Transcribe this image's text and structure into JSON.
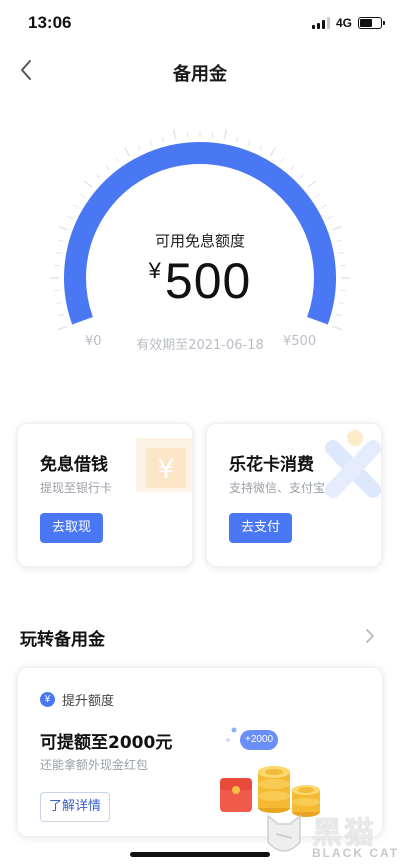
{
  "status_bar": {
    "time": "13:06",
    "network": "4G",
    "battery_level": 0.62
  },
  "nav": {
    "title": "备用金",
    "back_icon": "chevron-left-icon"
  },
  "gauge": {
    "label": "可用免息额度",
    "currency": "¥",
    "amount": "500",
    "min_label": "¥0",
    "max_label": "¥500",
    "validity": "有效期至2021-06-18",
    "fill_fraction": 1.0,
    "accent": "#4a78f5"
  },
  "cards": {
    "cash": {
      "title": "免息借钱",
      "subtitle": "提现至银行卡",
      "button": "去取现",
      "icon": "yen-card-icon"
    },
    "pay": {
      "title": "乐花卡消费",
      "subtitle": "支持微信、支付宝",
      "button": "去支付",
      "icon": "x-logo-icon"
    }
  },
  "section": {
    "title": "玩转备用金",
    "arrow_icon": "chevron-right-icon"
  },
  "promo": {
    "badge": "¥",
    "tag": "提升额度",
    "title": "可提额至2000元",
    "subtitle": "还能拿额外现金红包",
    "button": "了解详情",
    "bubble": "+2000",
    "art_icon": "coins-red-envelope-icon"
  },
  "watermark": {
    "cn": "黑猫",
    "en": "BLACK CAT",
    "icon": "black-cat-logo-icon"
  }
}
